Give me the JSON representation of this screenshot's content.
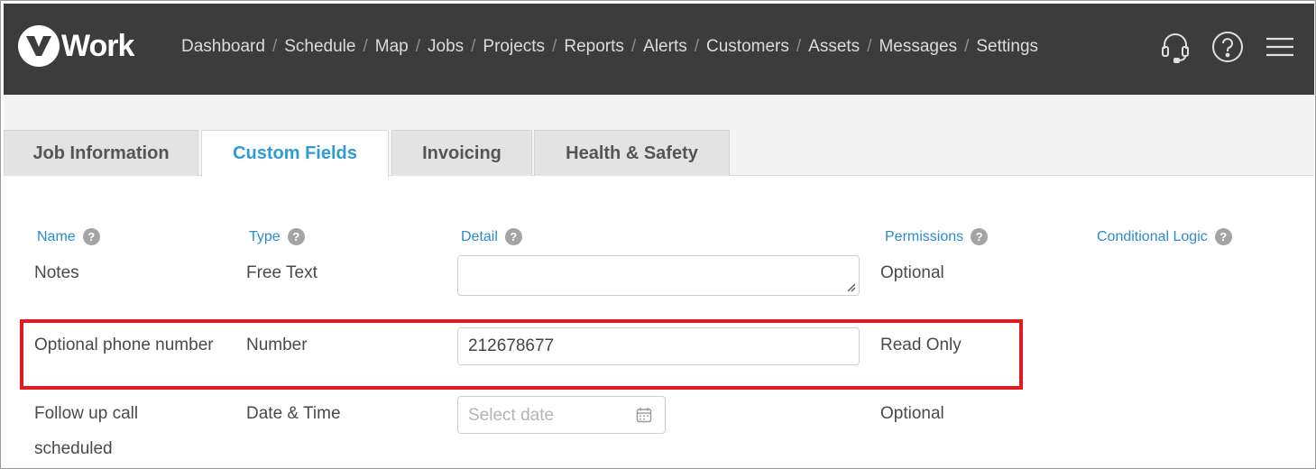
{
  "app": {
    "logo_text": "Work"
  },
  "nav": {
    "items": [
      "Dashboard",
      "Schedule",
      "Map",
      "Jobs",
      "Projects",
      "Reports",
      "Alerts",
      "Customers",
      "Assets",
      "Messages",
      "Settings"
    ],
    "separator": "/"
  },
  "tabs": [
    {
      "label": "Job Information",
      "active": false
    },
    {
      "label": "Custom Fields",
      "active": true
    },
    {
      "label": "Invoicing",
      "active": false
    },
    {
      "label": "Health & Safety",
      "active": false
    }
  ],
  "table": {
    "headers": {
      "name": "Name",
      "type": "Type",
      "detail": "Detail",
      "permissions": "Permissions",
      "conditional_logic": "Conditional Logic"
    },
    "help_glyph": "?",
    "rows": [
      {
        "name": "Notes",
        "type": "Free Text",
        "detail_value": "",
        "permissions": "Optional"
      },
      {
        "name": "Optional phone number",
        "type": "Number",
        "detail_value": "212678677",
        "permissions": "Read Only"
      },
      {
        "name_line1": "Follow up call",
        "name_line2": "scheduled",
        "type": "Date & Time",
        "detail_placeholder": "Select date",
        "permissions": "Optional"
      }
    ]
  },
  "colors": {
    "topbar": "#3c3c3c",
    "accent": "#2f9bd6",
    "highlight": "#e01b24"
  },
  "icons": [
    "headset-icon",
    "help-icon",
    "menu-icon",
    "calendar-icon",
    "help-circle-icon"
  ]
}
